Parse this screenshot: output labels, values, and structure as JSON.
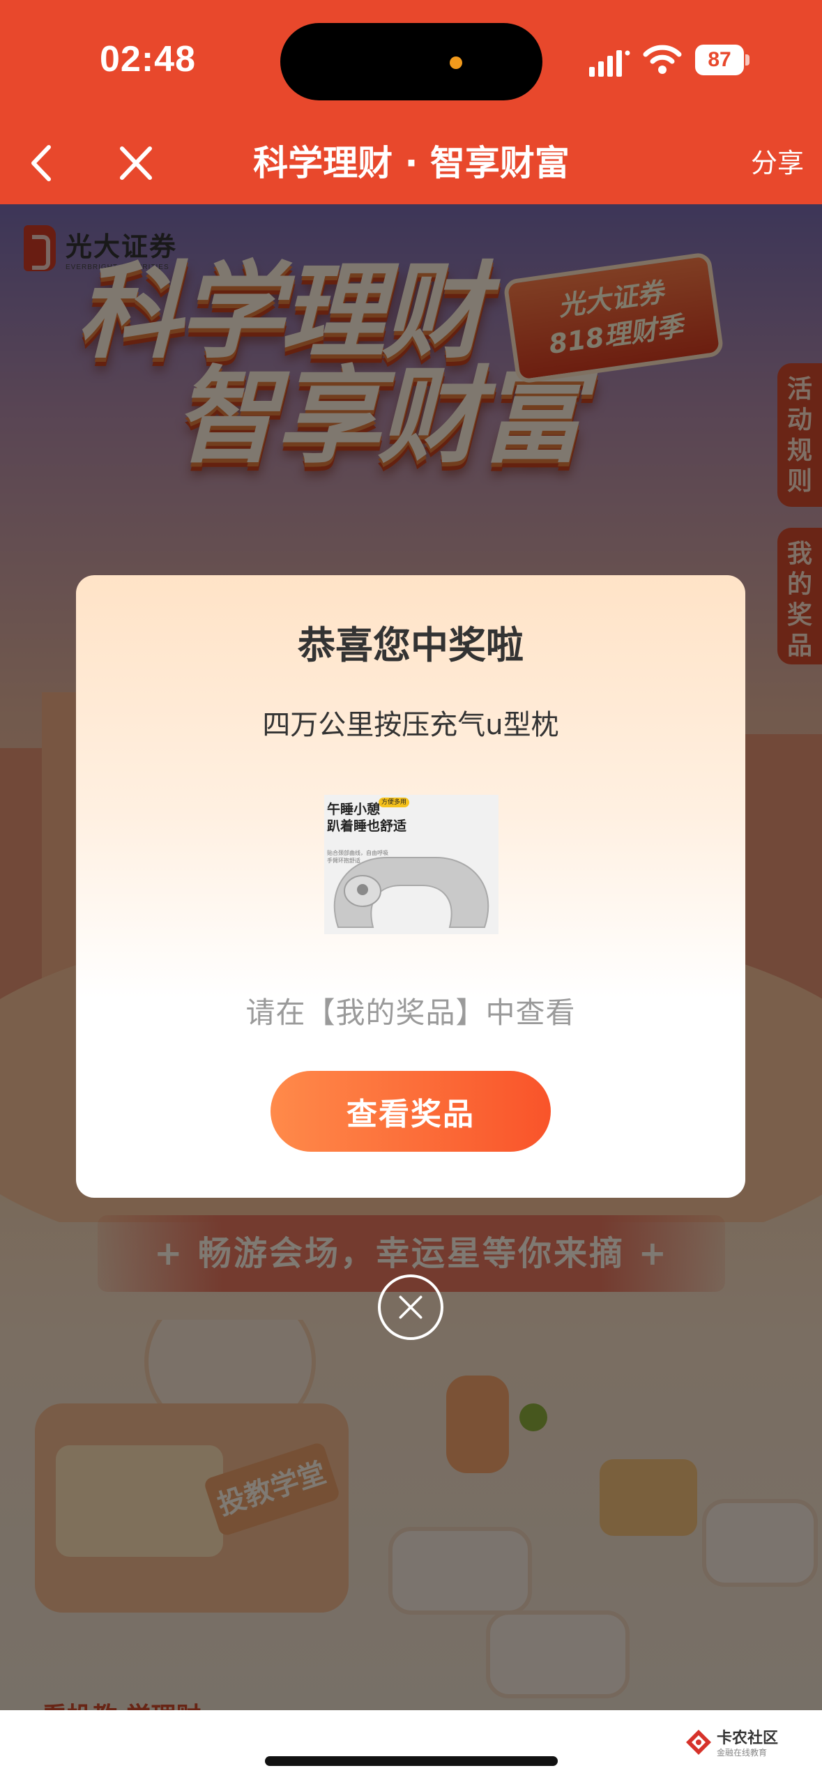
{
  "status_bar": {
    "time": "02:48",
    "battery": "87"
  },
  "nav": {
    "title": "科学理财 · 智享财富",
    "share": "分享"
  },
  "background": {
    "brand_cn": "光大证券",
    "brand_en": "EVERBRIGHT SECURITIES",
    "hero_line1": "科学理财",
    "hero_line2": "智享财富",
    "badge_line1": "光大证券",
    "badge_line2": "818理财季",
    "tab_rules": "活动规则",
    "tab_prizes": "我的奖品",
    "ribbon": "+ 畅游会场，幸运星等你来摘 +",
    "school_sign": "投教学堂",
    "bottom_peek": "看投教 学理财"
  },
  "modal": {
    "title": "恭喜您中奖啦",
    "prize_name": "四万公里按压充气u型枕",
    "image_text": {
      "tag": "方便多用",
      "line1": "午睡小憩",
      "line2": "趴着睡也舒适",
      "small1": "贴合颈部曲线，自由呼吸",
      "small2": "手臂环抱舒适"
    },
    "hint": "请在【我的奖品】中查看",
    "button": "查看奖品"
  },
  "watermark": {
    "name": "卡农社区",
    "sub": "金融在线教育"
  },
  "colors": {
    "brand_red": "#e8482c",
    "button_start": "#ff8a4a",
    "button_end": "#f9542a"
  }
}
